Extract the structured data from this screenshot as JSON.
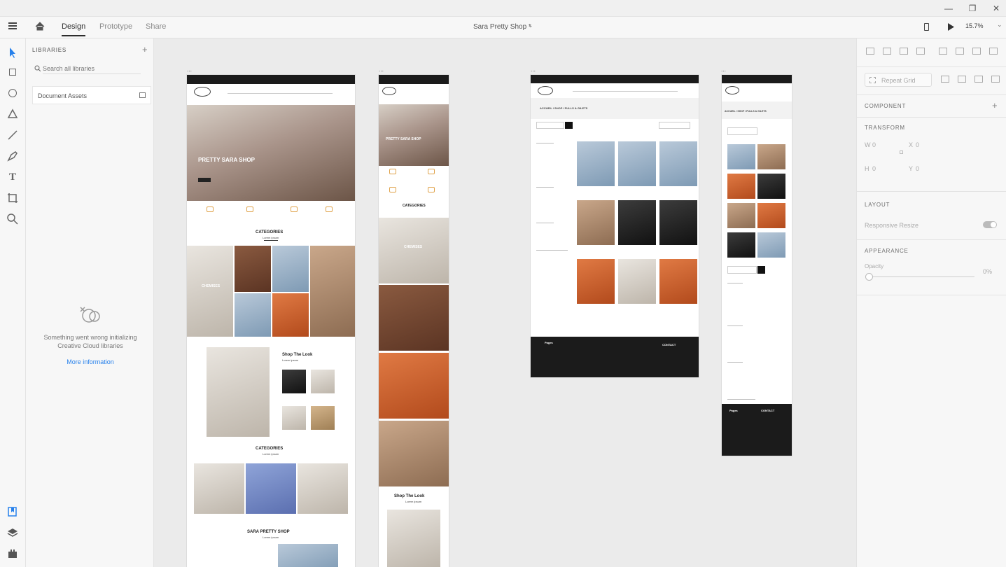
{
  "app": {
    "tabs": [
      {
        "label": "Design",
        "active": true
      },
      {
        "label": "Prototype",
        "active": false
      },
      {
        "label": "Share",
        "active": false
      }
    ],
    "document_title": "Sara Pretty Shop *",
    "zoom": "15.7%"
  },
  "libraries": {
    "header": "LIBRARIES",
    "search_placeholder": "Search all libraries",
    "document_assets": "Document Assets",
    "error_message": "Something went wrong initializing Creative Cloud libraries",
    "more_info": "More information"
  },
  "right_panel": {
    "repeat_grid": "Repeat Grid",
    "component": "COMPONENT",
    "transform": "TRANSFORM",
    "w_label": "W",
    "w_value": "0",
    "h_label": "H",
    "h_value": "0",
    "x_label": "X",
    "x_value": "0",
    "y_label": "Y",
    "y_value": "0",
    "layout": "LAYOUT",
    "responsive_resize": "Responsive Resize",
    "appearance": "APPEARANCE",
    "opacity_label": "Opacity",
    "opacity_value": "0%"
  },
  "artboards": {
    "desktop_home": {
      "hero_title": "PRETTY SARA SHOP",
      "categories_title": "CATEGORIES",
      "lorem": "Lorem ipsum",
      "chemises": "CHEMISES",
      "shop_the_look": "Shop The Look",
      "categories_title_2": "CATEGORIES",
      "sara_pretty_shop": "SARA PRETTY SHOP"
    },
    "mobile_home": {
      "hero_title": "PRETTY SARA SHOP",
      "categories_title": "CATEGORIES",
      "chemises": "CHEMISES",
      "shop_the_look": "Shop The Look",
      "lorem": "Lorem ipsum"
    },
    "desktop_shop": {
      "breadcrumb": "ACCUEIL / SHOP / PULLS & GILETS",
      "contact": "CONTACT",
      "pages": "Pages"
    },
    "mobile_shop": {
      "breadcrumb": "ACCUEIL / SHOP / PULLS & GILETS",
      "pages": "Pages",
      "contact": "CONTACT"
    }
  }
}
